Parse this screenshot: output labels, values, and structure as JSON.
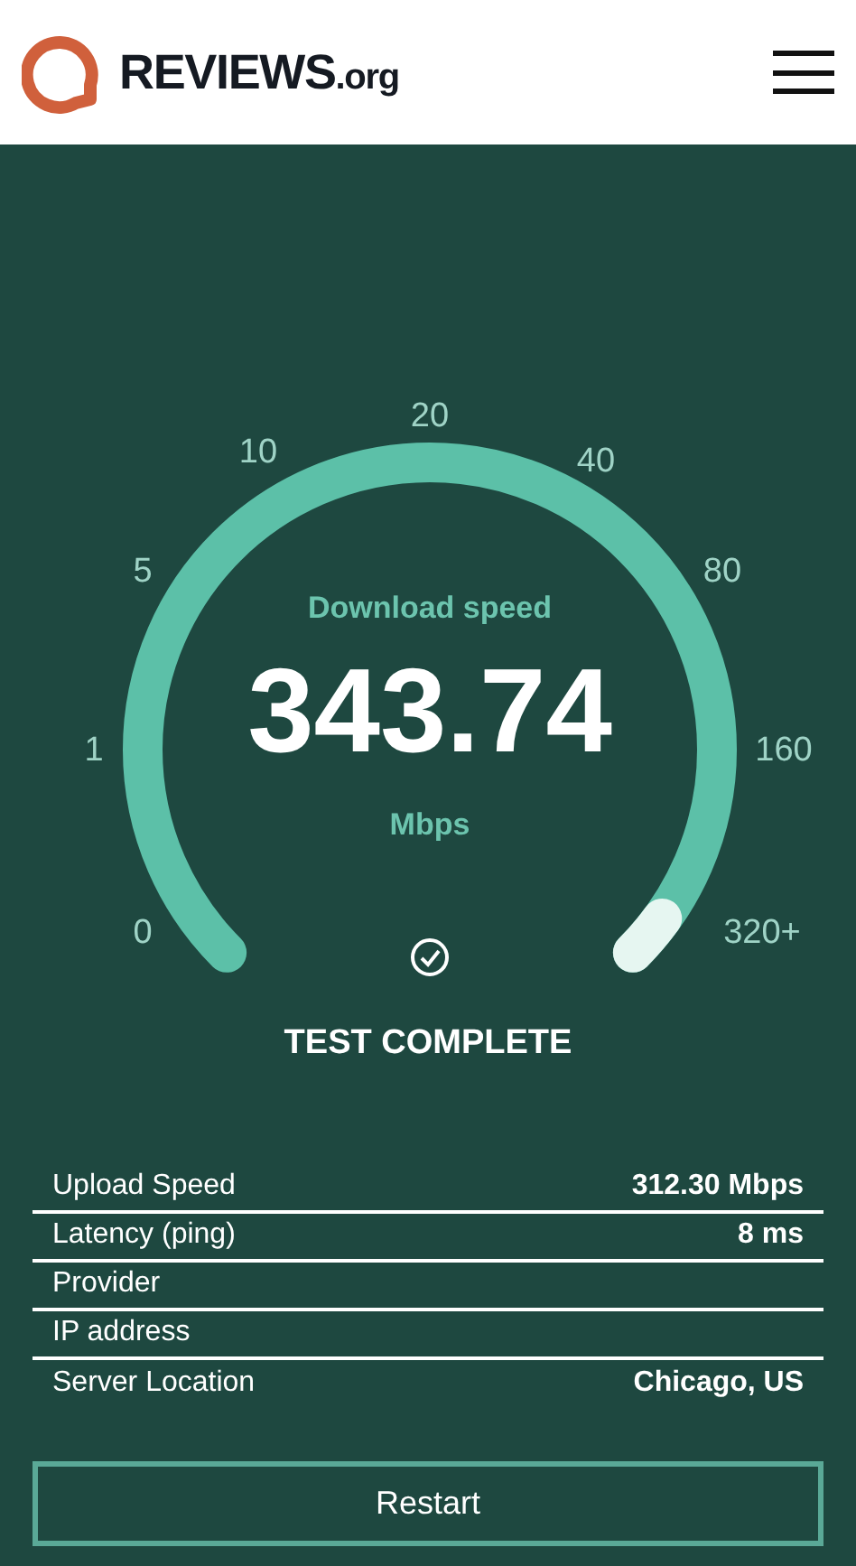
{
  "header": {
    "logo_text": "REVIEWS",
    "logo_suffix": ".org"
  },
  "gauge": {
    "ticks": [
      "0",
      "1",
      "5",
      "10",
      "20",
      "40",
      "80",
      "160",
      "320+"
    ],
    "label": "Download speed",
    "value": "343.74",
    "unit": "Mbps"
  },
  "status": {
    "text": "TEST COMPLETE",
    "complete": true
  },
  "results": [
    {
      "label": "Upload Speed",
      "value": "312.30 Mbps"
    },
    {
      "label": "Latency (ping)",
      "value": "8 ms"
    },
    {
      "label": "Provider"
    },
    {
      "label": "IP address"
    },
    {
      "label": "Server Location",
      "value": "Chicago, US"
    }
  ],
  "restart_button": "Restart"
}
